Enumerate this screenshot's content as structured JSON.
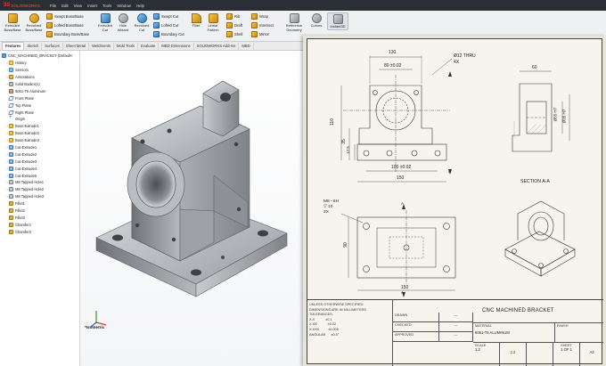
{
  "app": {
    "logo_mark": "3S",
    "brand": "SOLIDWORKS",
    "menu": [
      "File",
      "Edit",
      "View",
      "Insert",
      "Tools",
      "Window",
      "Help"
    ]
  },
  "ribbon": {
    "extruded_boss": "Extruded\nBoss/Base",
    "revolved_boss": "Revolved\nBoss/Base",
    "swept_boss": "Swept Boss/Base",
    "lofted_boss": "Lofted Boss/Base",
    "boundary_boss": "Boundary Boss/Base",
    "extruded_cut": "Extruded\nCut",
    "hole_wizard": "Hole\nWizard",
    "revolved_cut": "Revolved\nCut",
    "swept_cut": "Swept Cut",
    "lofted_cut": "Lofted Cut",
    "boundary_cut": "Boundary Cut",
    "fillet": "Fillet",
    "linear_pattern": "Linear\nPattern",
    "rib": "Rib",
    "draft": "Draft",
    "shell": "Shell",
    "wrap": "Wrap",
    "intersect": "Intersect",
    "mirror": "Mirror",
    "reference_geometry": "Reference\nGeometry",
    "curves": "Curves",
    "instant3d": "Instant3D"
  },
  "tabs": [
    "Features",
    "Sketch",
    "Surfaces",
    "Sheet Metal",
    "Weldments",
    "Mold Tools",
    "Evaluate",
    "MBD Dimensions",
    "SOLIDWORKS Add-Ins",
    "MBD"
  ],
  "tree": {
    "root": "CNC_MACHINED_BRACKET (Default<",
    "items": [
      {
        "label": "History",
        "icon": "folder"
      },
      {
        "label": "Sensors",
        "icon": "sensor"
      },
      {
        "label": "Annotations",
        "icon": "annot"
      },
      {
        "label": "Solid Bodies(1)",
        "icon": "body"
      },
      {
        "label": "6061-T6 Aluminum",
        "icon": "mat"
      },
      {
        "label": "Front Plane",
        "icon": "plane"
      },
      {
        "label": "Top Plane",
        "icon": "plane"
      },
      {
        "label": "Right Plane",
        "icon": "plane"
      },
      {
        "label": "Origin",
        "icon": "origin"
      },
      {
        "label": "Boss-Extrude1",
        "icon": "feat"
      },
      {
        "label": "Boss-Extrude2",
        "icon": "feat"
      },
      {
        "label": "Boss-Extrude3",
        "icon": "feat"
      },
      {
        "label": "Cut-Extrude1",
        "icon": "cut"
      },
      {
        "label": "Cut-Extrude2",
        "icon": "cut"
      },
      {
        "label": "Cut-Extrude3",
        "icon": "cut"
      },
      {
        "label": "Cut-Extrude4",
        "icon": "cut"
      },
      {
        "label": "Cut-Extrude5",
        "icon": "cut"
      },
      {
        "label": "M8 Tapped Hole1",
        "icon": "hole"
      },
      {
        "label": "M8 Tapped Hole2",
        "icon": "hole"
      },
      {
        "label": "M8 Tapped Hole3",
        "icon": "hole"
      },
      {
        "label": "Fillet1",
        "icon": "fillet"
      },
      {
        "label": "Fillet2",
        "icon": "fillet"
      },
      {
        "label": "Fillet3",
        "icon": "fillet"
      },
      {
        "label": "Chamfer1",
        "icon": "fillet"
      },
      {
        "label": "Chamfer2",
        "icon": "fillet"
      }
    ]
  },
  "viewport": {
    "view_label": "*Isometric"
  },
  "drawing": {
    "dims_front": {
      "top_width": "130",
      "bore_span": "80 ±0.02",
      "hole_note_1": "Ø12 THRU",
      "hole_note_2": "4X",
      "left_height": "110",
      "mid_height": "35",
      "bottom_height": "17.5",
      "hole_pitch": "100 ±0.02",
      "overall_width": "150"
    },
    "dims_side": {
      "width": "60",
      "bore_1": "Ø55 H7",
      "bore_2": "Ø35 H7"
    },
    "section_label": "SECTION A-A",
    "section_marker": "A",
    "tap_note": [
      "M8 - 6H",
      "▽ 10",
      "3X"
    ],
    "dims_plan": {
      "depth": "90",
      "width": "150"
    },
    "title_block": {
      "unless": "UNLESS OTHERWISE SPECIFIED:",
      "dims_in": "DIMENSIONS ARE IN MILLIMETERS",
      "tolerances": "TOLERANCES:",
      "tol_rows": [
        {
          "k": "X.X",
          "v": "±0.1"
        },
        {
          "k": "X.XX",
          "v": "±0.02"
        },
        {
          "k": "X.XXX",
          "v": "±0.005"
        },
        {
          "k": "ANGULAR",
          "v": "±0.5°"
        }
      ],
      "drawn": "DRAWN",
      "checked": "CHECKED",
      "approved": "APPROVED",
      "dash": "—",
      "title": "CNC MACHINED BRACKET",
      "material_label": "MATERIAL",
      "material": "6061-T6 ALUMINUM",
      "finish_label": "FINISH",
      "scale_label": "SCALE",
      "scale": "1:2",
      "scale_val": "1:2",
      "sheet_label": "SHEET",
      "sheet": "1 OF 1",
      "size": "A3"
    }
  },
  "colors": {
    "menubar": "#2a2f36",
    "brand_red": "#e03a2f",
    "sheet": "#f6f4ec"
  }
}
